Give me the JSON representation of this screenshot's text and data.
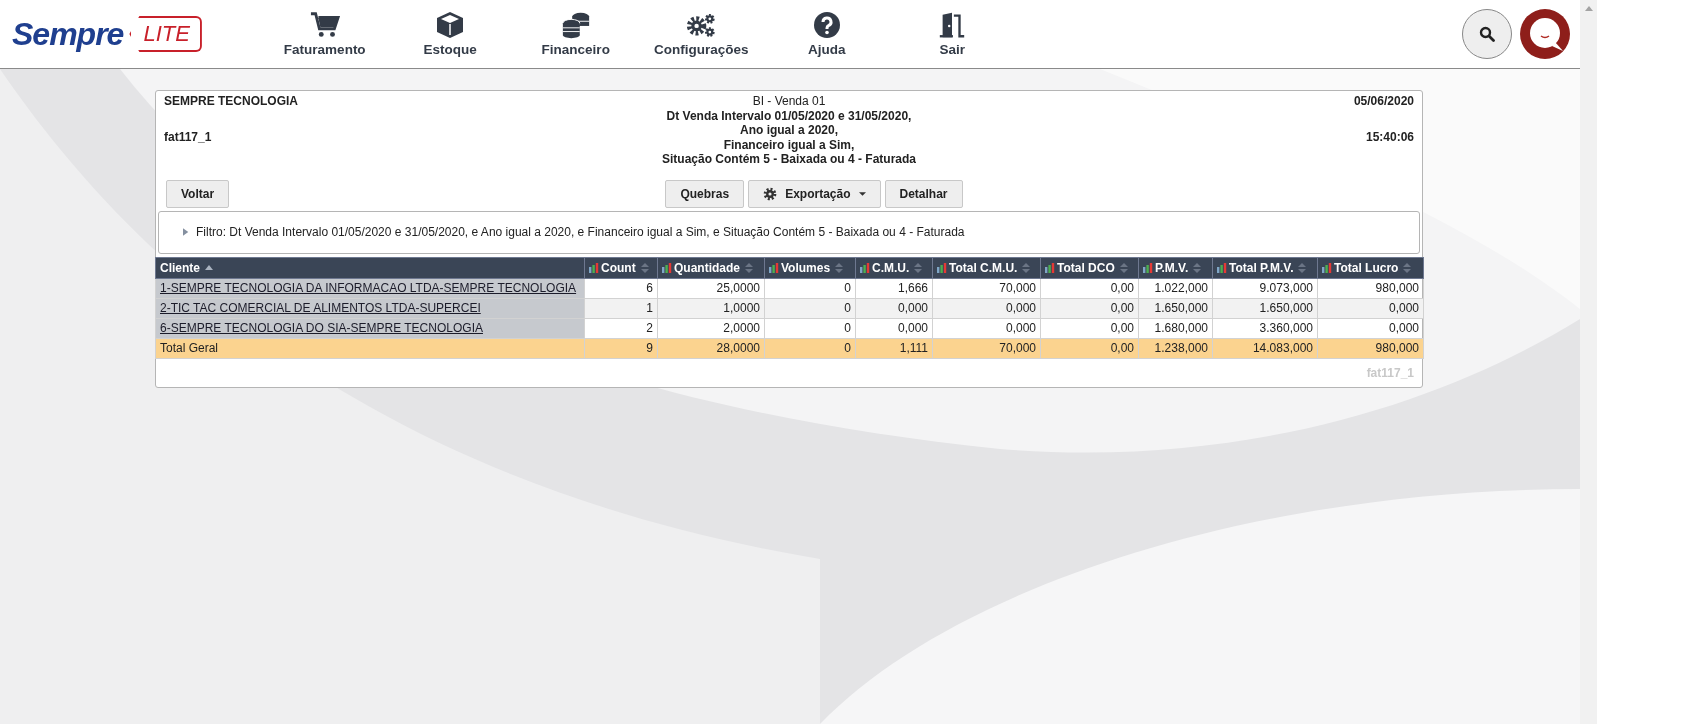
{
  "brand": {
    "name": "Sempre",
    "tag": "LITE"
  },
  "nav": [
    {
      "label": "Faturamento",
      "kind": "cart"
    },
    {
      "label": "Estoque",
      "kind": "box"
    },
    {
      "label": "Financeiro",
      "kind": "coins"
    },
    {
      "label": "Configurações",
      "kind": "gears"
    },
    {
      "label": "Ajuda",
      "kind": "help"
    },
    {
      "label": "Sair",
      "kind": "exit"
    }
  ],
  "report": {
    "company": "SEMPRE TECNOLOGIA",
    "code": "fat117_1",
    "title": "BI - Venda 01",
    "criteria": [
      "Dt Venda Intervalo 01/05/2020 e 31/05/2020,",
      "Ano igual a 2020,",
      "Financeiro igual a Sim,",
      "Situação Contém 5 - Baixada ou 4 - Faturada"
    ],
    "date": "05/06/2020",
    "time": "15:40:06"
  },
  "back_button": "Voltar",
  "actions": [
    {
      "label": "Quebras",
      "kind": "plain"
    },
    {
      "label": "Exportação",
      "kind": "menu"
    },
    {
      "label": "Detalhar",
      "kind": "plain"
    }
  ],
  "filter": {
    "text": "Filtro: Dt Venda Intervalo 01/05/2020 e 31/05/2020, e Ano igual a 2020, e Financeiro igual a Sim, e Situação Contém 5 - Baixada ou 4 - Faturada",
    "expanded": false
  },
  "table": {
    "columns": [
      {
        "label": "Cliente",
        "kind": "text",
        "sorted": true
      },
      {
        "label": "Count",
        "kind": "measure",
        "sorted": false
      },
      {
        "label": "Quantidade",
        "kind": "measure",
        "sorted": false
      },
      {
        "label": "Volumes",
        "kind": "measure",
        "sorted": false
      },
      {
        "label": "C.M.U.",
        "kind": "measure",
        "sorted": false
      },
      {
        "label": "Total C.M.U.",
        "kind": "measure",
        "sorted": false
      },
      {
        "label": "Total DCO",
        "kind": "measure",
        "sorted": false
      },
      {
        "label": "P.M.V.",
        "kind": "measure",
        "sorted": false
      },
      {
        "label": "Total P.M.V.",
        "kind": "measure",
        "sorted": false
      },
      {
        "label": "Total Lucro",
        "kind": "measure",
        "sorted": false
      }
    ],
    "rows": [
      {
        "kind": "data",
        "cells": [
          "1-SEMPRE TECNOLOGIA DA INFORMACAO LTDA-SEMPRE TECNOLOGIA",
          "6",
          "25,0000",
          "0",
          "1,666",
          "70,000",
          "0,00",
          "1.022,000",
          "9.073,000",
          "980,000"
        ]
      },
      {
        "kind": "data",
        "cells": [
          "2-TIC TAC COMERCIAL DE ALIMENTOS LTDA-SUPERCEI",
          "1",
          "1,0000",
          "0",
          "0,000",
          "0,000",
          "0,00",
          "1.650,000",
          "1.650,000",
          "0,000"
        ]
      },
      {
        "kind": "data",
        "cells": [
          "6-SEMPRE TECNOLOGIA DO SIA-SEMPRE TECNOLOGIA",
          "2",
          "2,0000",
          "0",
          "0,000",
          "0,000",
          "0,00",
          "1.680,000",
          "3.360,000",
          "0,000"
        ]
      },
      {
        "kind": "total",
        "cells": [
          "Total Geral",
          "9",
          "28,0000",
          "0",
          "1,111",
          "70,000",
          "0,00",
          "1.238,000",
          "14.083,000",
          "980,000"
        ]
      }
    ]
  },
  "footer_code": "fat117_1"
}
